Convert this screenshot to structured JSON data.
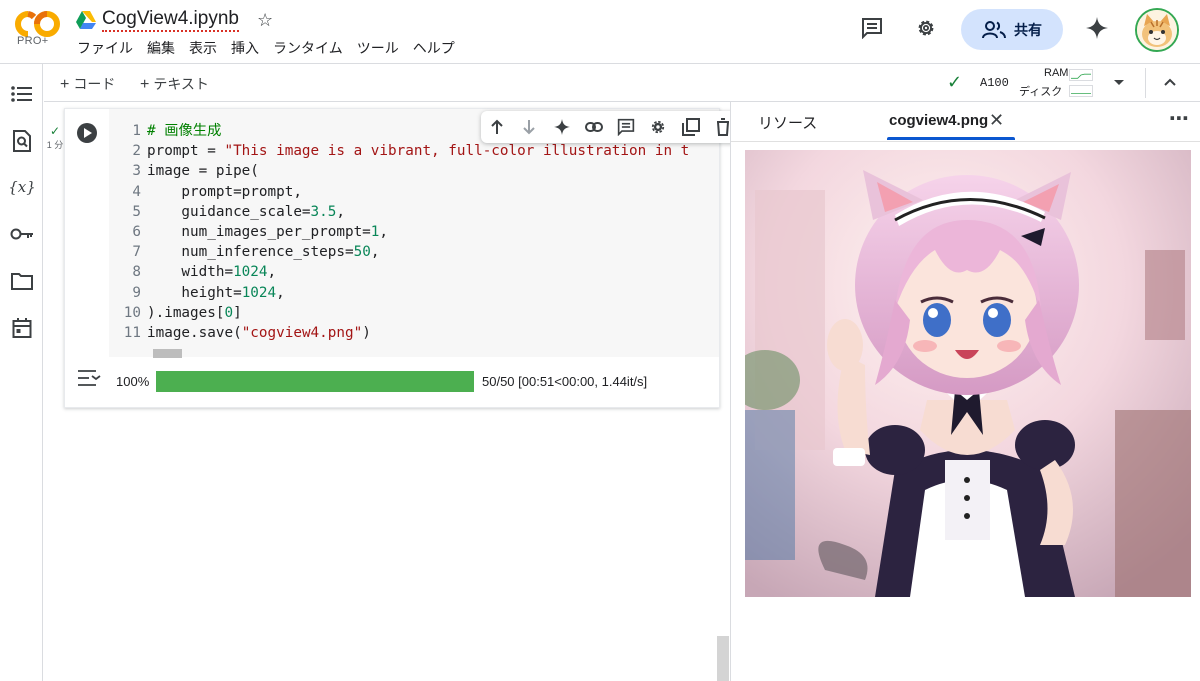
{
  "header": {
    "logo_tier": "PRO+",
    "notebook_title": "CogView4.ipynb",
    "menu": [
      "ファイル",
      "編集",
      "表示",
      "挿入",
      "ランタイム",
      "ツール",
      "ヘルプ"
    ],
    "share_label": "共有"
  },
  "toolbar": {
    "add_code": "コード",
    "add_text": "テキスト",
    "runtime_name": "A100",
    "ram_label": "RAM",
    "disk_label": "ディスク"
  },
  "cell": {
    "status_time": "1 分",
    "code": [
      {
        "n": "1",
        "parts": [
          {
            "t": "# 画像生成",
            "c": "comment"
          }
        ]
      },
      {
        "n": "2",
        "parts": [
          {
            "t": "prompt = ",
            "c": "def"
          },
          {
            "t": "\"This image is a vibrant, full-color illustration in t",
            "c": "str"
          }
        ]
      },
      {
        "n": "3",
        "parts": [
          {
            "t": "image = pipe(",
            "c": "def"
          }
        ]
      },
      {
        "n": "4",
        "parts": [
          {
            "t": "    prompt=prompt,",
            "c": "def"
          }
        ]
      },
      {
        "n": "5",
        "parts": [
          {
            "t": "    guidance_scale=",
            "c": "def"
          },
          {
            "t": "3.5",
            "c": "num"
          },
          {
            "t": ",",
            "c": "def"
          }
        ]
      },
      {
        "n": "6",
        "parts": [
          {
            "t": "    num_images_per_prompt=",
            "c": "def"
          },
          {
            "t": "1",
            "c": "num"
          },
          {
            "t": ",",
            "c": "def"
          }
        ]
      },
      {
        "n": "7",
        "parts": [
          {
            "t": "    num_inference_steps=",
            "c": "def"
          },
          {
            "t": "50",
            "c": "num"
          },
          {
            "t": ",",
            "c": "def"
          }
        ]
      },
      {
        "n": "8",
        "parts": [
          {
            "t": "    width=",
            "c": "def"
          },
          {
            "t": "1024",
            "c": "num"
          },
          {
            "t": ",",
            "c": "def"
          }
        ]
      },
      {
        "n": "9",
        "parts": [
          {
            "t": "    height=",
            "c": "def"
          },
          {
            "t": "1024",
            "c": "num"
          },
          {
            "t": ",",
            "c": "def"
          }
        ]
      },
      {
        "n": "10",
        "parts": [
          {
            "t": ").images[",
            "c": "def"
          },
          {
            "t": "0",
            "c": "num"
          },
          {
            "t": "]",
            "c": "def"
          }
        ]
      },
      {
        "n": "11",
        "parts": [
          {
            "t": "image.save(",
            "c": "def"
          },
          {
            "t": "\"cogview4.png\"",
            "c": "str"
          },
          {
            "t": ")",
            "c": "def"
          }
        ]
      }
    ],
    "output": {
      "percent_label": "100%",
      "progress": 1.0,
      "stats": "50/50 [00:51<00:00,  1.44it/s]"
    }
  },
  "panel": {
    "tab_resources": "リソース",
    "tab_file": "cogview4.png"
  },
  "icons": {
    "drive": "google-drive-icon",
    "star": "star-icon",
    "comments": "comment-icon",
    "settings": "gear-icon",
    "gemini": "sparkle-icon"
  },
  "colors": {
    "accent": "#0b57d0",
    "share_bg": "#d3e3fd",
    "progress": "#4caf50",
    "ok": "#188038"
  }
}
